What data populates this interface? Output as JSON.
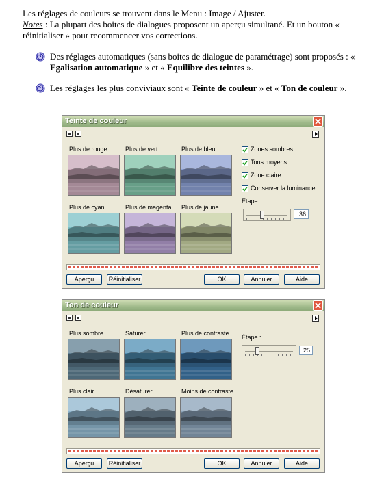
{
  "doc": {
    "line1": "Les réglages de couleurs se trouvent dans le Menu : Image / Ajuster.",
    "notes_label": "Notes",
    "notes_text": " : La plupart des boites de dialogues proposent un aperçu simultané. Et un bouton « réinitialiser » pour recommencer vos corrections.",
    "bullet1_a": "Des réglages automatiques (sans boites de dialogue de paramétrage) sont proposés : « ",
    "bullet1_b": "Egalisation automatique",
    "bullet1_c": " » et « ",
    "bullet1_d": "Equilibre des teintes",
    "bullet1_e": " ».",
    "bullet2_a": "Les réglages les plus conviviaux sont « ",
    "bullet2_b": "Teinte de couleur",
    "bullet2_c": " » et « ",
    "bullet2_d": "Ton de couleur",
    "bullet2_e": " »."
  },
  "dialog1": {
    "title": "Teinte de couleur",
    "thumbs": [
      {
        "label": "Plus de rouge",
        "tint": "#c9a8b8"
      },
      {
        "label": "Plus de vert",
        "tint": "#7fc2a6"
      },
      {
        "label": "Plus de bleu",
        "tint": "#8c9fd2"
      },
      {
        "label": "Plus de cyan",
        "tint": "#7cc0c6"
      },
      {
        "label": "Plus de magenta",
        "tint": "#b29ccc"
      },
      {
        "label": "Plus de jaune",
        "tint": "#c6cfa0"
      }
    ],
    "checkboxes": [
      {
        "label": "Zones sombres",
        "checked": true
      },
      {
        "label": "Tons moyens",
        "checked": true
      },
      {
        "label": "Zone claire",
        "checked": true
      },
      {
        "label": "Conserver la luminance",
        "checked": true
      }
    ],
    "step_label": "Étape :",
    "step_value": "36",
    "buttons": {
      "preview": "Aperçu",
      "reset": "Réinitialiser",
      "ok": "OK",
      "cancel": "Annuler",
      "help": "Aide"
    }
  },
  "dialog2": {
    "title": "Ton de couleur",
    "thumbs": [
      {
        "label": "Plus sombre",
        "tint": "#5f7f92"
      },
      {
        "label": "Saturer",
        "tint": "#4f8fb4"
      },
      {
        "label": "Plus de contraste",
        "tint": "#3e77a6"
      },
      {
        "label": "Plus clair",
        "tint": "#8fb6ce"
      },
      {
        "label": "Désaturer",
        "tint": "#7d96a8"
      },
      {
        "label": "Moins de contraste",
        "tint": "#8aa2b8"
      }
    ],
    "step_label": "Étape :",
    "step_value": "25",
    "buttons": {
      "preview": "Aperçu",
      "reset": "Réinitialiser",
      "ok": "OK",
      "cancel": "Annuler",
      "help": "Aide"
    }
  },
  "colors": {
    "titlebar": "#9fb98a",
    "dialog_bg": "#ece9d8",
    "close": "#e0583e"
  }
}
